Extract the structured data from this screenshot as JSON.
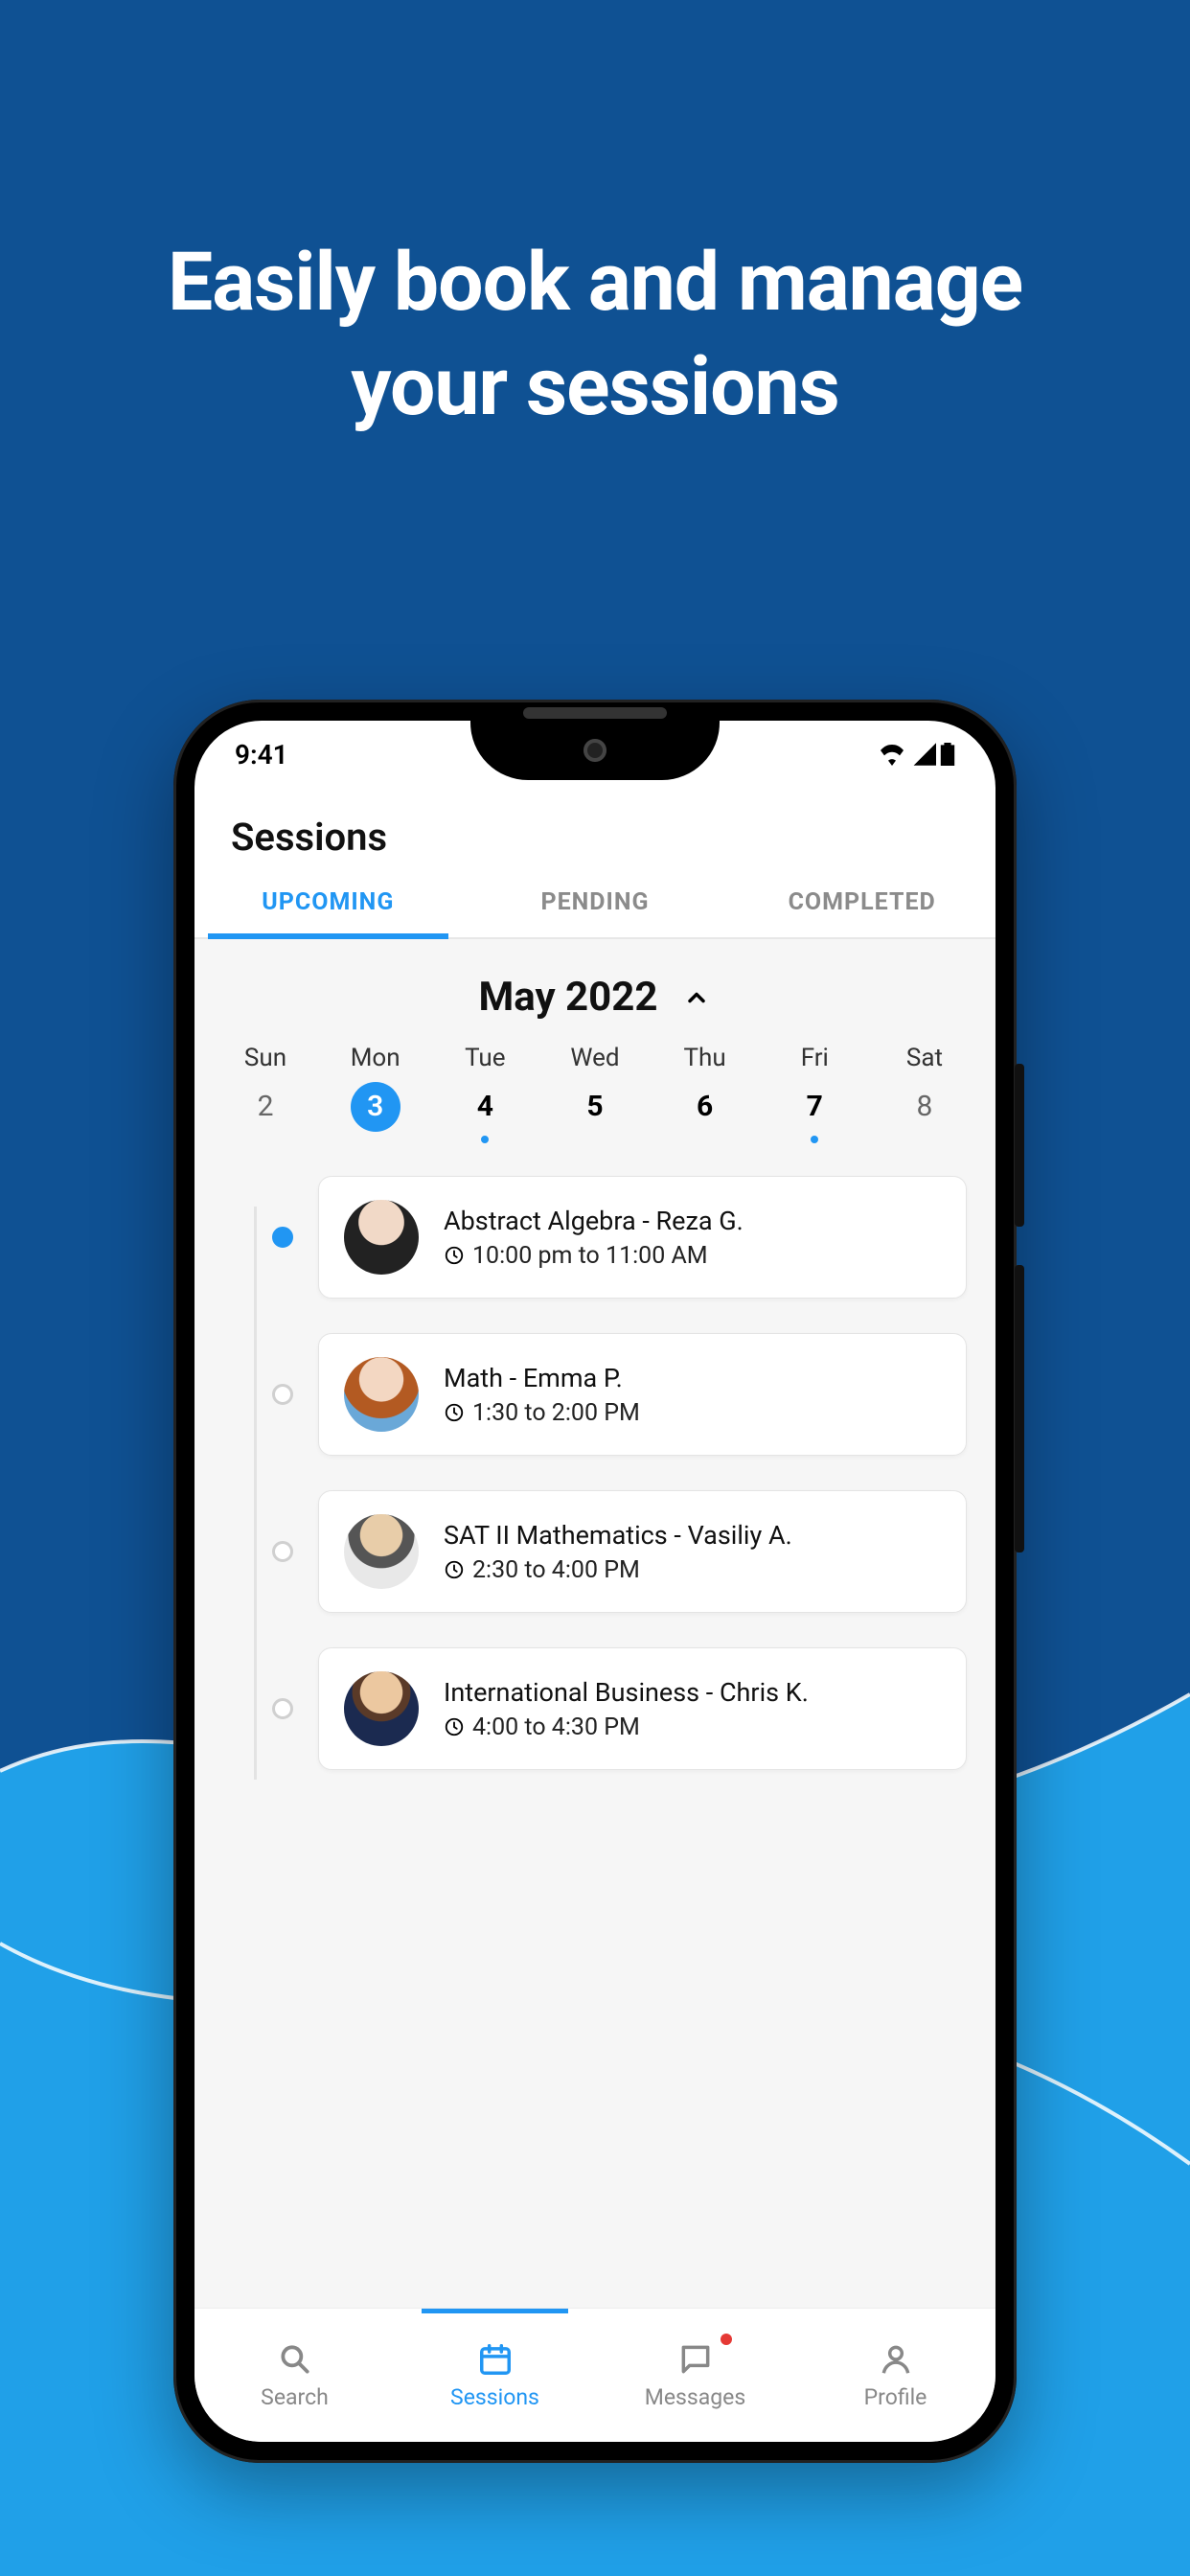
{
  "marketing": {
    "headline_line1": "Easily book and manage",
    "headline_line2": "your sessions"
  },
  "statusbar": {
    "time": "9:41"
  },
  "page": {
    "title": "Sessions"
  },
  "tabs": [
    {
      "label": "UPCOMING",
      "active": true
    },
    {
      "label": "PENDING",
      "active": false
    },
    {
      "label": "COMPLETED",
      "active": false
    }
  ],
  "calendar": {
    "month_label": "May 2022",
    "days": [
      {
        "dow": "Sun",
        "num": "2",
        "selected": false,
        "bold": false,
        "dot": false
      },
      {
        "dow": "Mon",
        "num": "3",
        "selected": true,
        "bold": false,
        "dot": false
      },
      {
        "dow": "Tue",
        "num": "4",
        "selected": false,
        "bold": true,
        "dot": true
      },
      {
        "dow": "Wed",
        "num": "5",
        "selected": false,
        "bold": true,
        "dot": false
      },
      {
        "dow": "Thu",
        "num": "6",
        "selected": false,
        "bold": true,
        "dot": false
      },
      {
        "dow": "Fri",
        "num": "7",
        "selected": false,
        "bold": true,
        "dot": true
      },
      {
        "dow": "Sat",
        "num": "8",
        "selected": false,
        "bold": false,
        "dot": false
      }
    ]
  },
  "sessions": [
    {
      "title": "Abstract Algebra - Reza G.",
      "time": "10:00 pm to 11:00 AM",
      "avatar": "av1",
      "active": true
    },
    {
      "title": "Math - Emma P.",
      "time": "1:30 to 2:00 PM",
      "avatar": "av2",
      "active": false
    },
    {
      "title": "SAT II Mathematics - Vasiliy A.",
      "time": "2:30 to 4:00 PM",
      "avatar": "av3",
      "active": false
    },
    {
      "title": "International Business - Chris K.",
      "time": "4:00 to 4:30 PM",
      "avatar": "av4",
      "active": false
    }
  ],
  "nav": [
    {
      "label": "Search",
      "icon": "search",
      "active": false,
      "badge": false
    },
    {
      "label": "Sessions",
      "icon": "calendar",
      "active": true,
      "badge": false
    },
    {
      "label": "Messages",
      "icon": "chat",
      "active": false,
      "badge": true
    },
    {
      "label": "Profile",
      "icon": "person",
      "active": false,
      "badge": false
    }
  ],
  "colors": {
    "accent": "#2196f3",
    "bg_dark": "#0f5193",
    "bg_light": "#20a0e8"
  }
}
